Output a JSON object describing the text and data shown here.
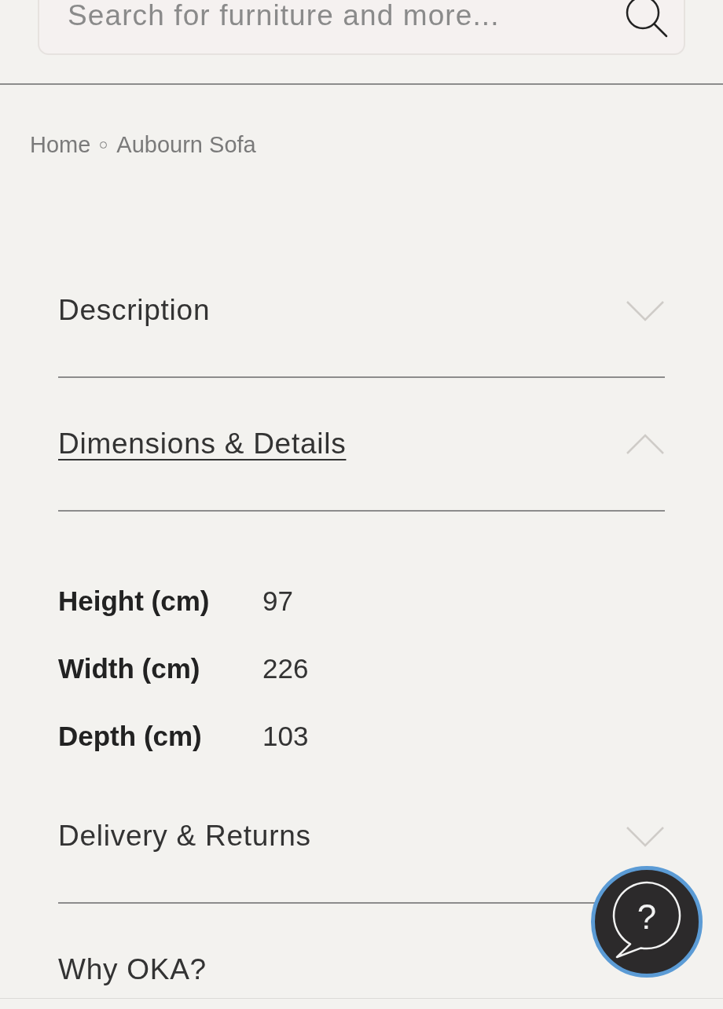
{
  "search": {
    "placeholder": "Search for furniture and more..."
  },
  "breadcrumb": [
    {
      "label": "Home"
    },
    {
      "label": "Aubourn Sofa"
    }
  ],
  "accordion": [
    {
      "title": "Description",
      "expanded": false
    },
    {
      "title": "Dimensions & Details",
      "expanded": true,
      "details": [
        {
          "label": "Height (cm)",
          "value": "97"
        },
        {
          "label": "Width (cm)",
          "value": "226"
        },
        {
          "label": "Depth (cm)",
          "value": "103"
        }
      ]
    },
    {
      "title": "Delivery & Returns",
      "expanded": false
    },
    {
      "title": "Why OKA?"
    }
  ],
  "help_button": {
    "label": "?"
  }
}
